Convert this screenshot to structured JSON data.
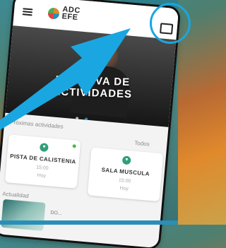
{
  "header": {
    "menu_icon": "hamburger-menu-icon",
    "logo_text_line1": "ADC",
    "logo_text_line2": "EFE",
    "card_icon": "id-card-icon"
  },
  "hero": {
    "title_line1": "RESERVA DE",
    "title_line2": "ACTIVIDADES"
  },
  "upcoming": {
    "section_title": "Próximas actividades",
    "see_all_label": "Todos",
    "items": [
      {
        "name": "PISTA DE CALISTENIA",
        "time": "15:00",
        "day": "Hoy"
      },
      {
        "name": "SALA MUSCULA",
        "time": "15:00",
        "day": "Hoy"
      }
    ]
  },
  "news": {
    "section_title": "Actualidad",
    "item_label": "DO..."
  },
  "colors": {
    "accent": "#2a8fb8",
    "activity_icon": "#2e9f7a",
    "status_available": "#3cc14a",
    "annotation": "#1aa6e0"
  }
}
